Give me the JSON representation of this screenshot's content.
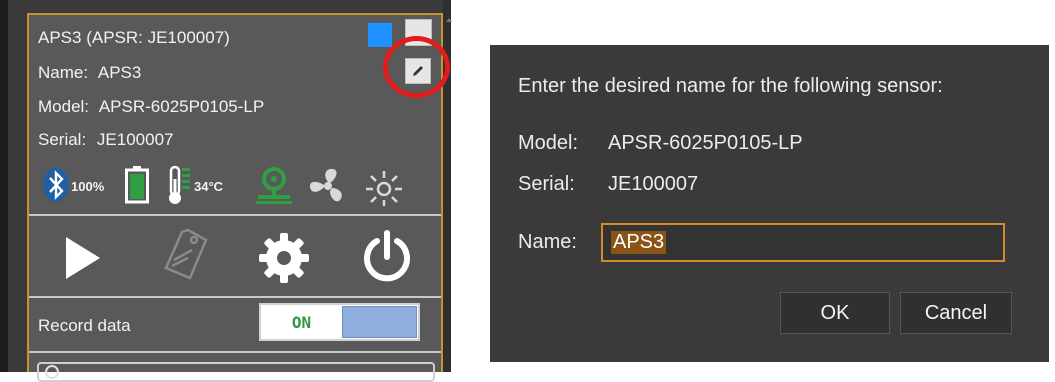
{
  "sensor_card": {
    "title": "APS3 (APSR: JE100007)",
    "name_label": "Name:",
    "name_value": "APS3",
    "model_label": "Model:",
    "model_value": "APSR-6025P0105-LP",
    "serial_label": "Serial:",
    "serial_value": "JE100007",
    "color_swatch": "#1e90ff",
    "status": {
      "bluetooth_icon": "bluetooth-icon",
      "battery_level": "100%",
      "battery_icon": "battery-full-icon",
      "temperature": "34°C",
      "thermometer_icon": "thermometer-icon",
      "connection_icon": "tripod-camera-icon",
      "fan_icon": "fan-icon",
      "light_icon": "sun-icon"
    },
    "actions": {
      "play_icon": "play-icon",
      "tag_icon": "tag-icon",
      "settings_icon": "gear-icon",
      "power_icon": "power-icon"
    },
    "record_label": "Record data",
    "record_toggle_state": "ON"
  },
  "rename_dialog": {
    "prompt": "Enter the desired name for the following sensor:",
    "model_label": "Model:",
    "model_value": "APSR-6025P0105-LP",
    "serial_label": "Serial:",
    "serial_value": "JE100007",
    "name_label": "Name:",
    "name_input_value": "APS3",
    "ok_label": "OK",
    "cancel_label": "Cancel"
  },
  "colors": {
    "card_border": "#c8922e",
    "highlight_circle": "#e21b1b",
    "ok_toggle_text": "#2c9a3c",
    "input_border": "#d58a28"
  }
}
